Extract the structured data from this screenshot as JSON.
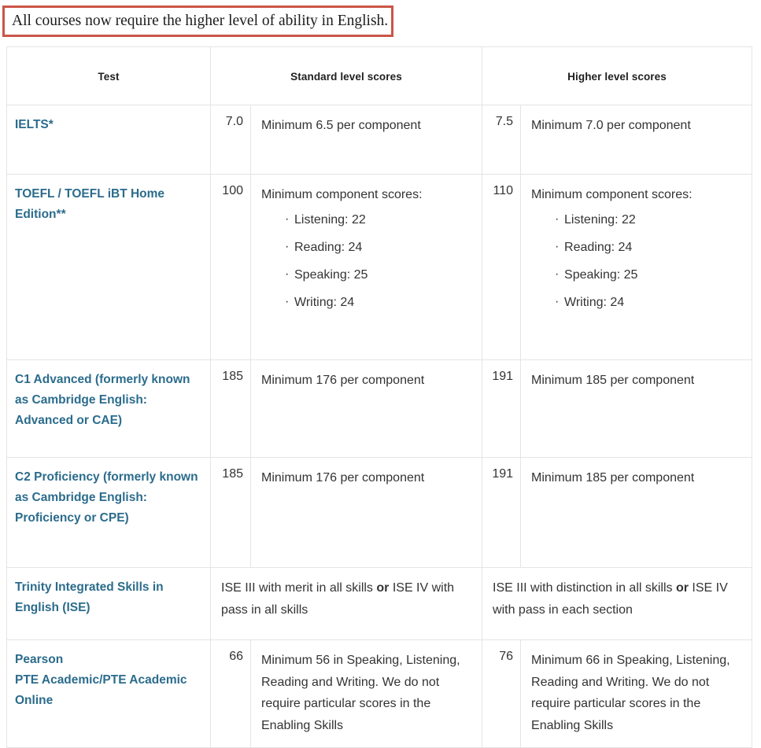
{
  "notice": {
    "text": "All courses now require the higher level of ability in English."
  },
  "table": {
    "headers": {
      "test": "Test",
      "standard": "Standard level scores",
      "higher": "Higher level scores"
    },
    "rows": [
      {
        "id": "ielts",
        "test_links": [
          "IELTS"
        ],
        "separator": "",
        "suffix": "*",
        "standard_score": "7.0",
        "standard_desc": "Minimum 6.5 per component",
        "higher_score": "7.5",
        "higher_desc": "Minimum 7.0 per component"
      },
      {
        "id": "toefl",
        "test_links": [
          "TOEFL",
          "TOEFL iBT Home Edition"
        ],
        "separator": " / ",
        "suffix": "**",
        "standard_score": "100",
        "standard_desc": "Minimum component scores:",
        "standard_components": [
          "Listening: 22",
          "Reading: 24",
          "Speaking: 25",
          "Writing: 24"
        ],
        "higher_score": "110",
        "higher_desc": "Minimum component scores:",
        "higher_components": [
          "Listening: 22",
          "Reading: 24",
          "Speaking: 25",
          "Writing: 24"
        ]
      },
      {
        "id": "c1",
        "test_links": [
          "C1 Advanced (formerly known as Cambridge English: Advanced or CAE)"
        ],
        "separator": "",
        "suffix": "",
        "standard_score": "185",
        "standard_desc": "Minimum 176 per component",
        "higher_score": "191",
        "higher_desc": "Minimum 185 per component"
      },
      {
        "id": "c2",
        "test_links": [
          "C2 Proficiency (formerly known as Cambridge English: Proficiency or CPE)"
        ],
        "separator": "",
        "suffix": "",
        "standard_score": "185",
        "standard_desc": "Minimum 176 per component",
        "higher_score": "191",
        "higher_desc": "Minimum 185 per component"
      },
      {
        "id": "trinity",
        "test_links": [
          "Trinity Integrated Skills in English (ISE)"
        ],
        "separator": "",
        "suffix": "",
        "standard_span_pre": "ISE III with merit in all skills ",
        "standard_span_bold": "or",
        "standard_span_post": " ISE IV with pass in all skills",
        "higher_span_pre": "ISE III with distinction in all skills ",
        "higher_span_bold": "or",
        "higher_span_post": " ISE IV with pass in each section"
      },
      {
        "id": "pearson",
        "test_links": [
          "Pearson",
          "PTE Academic/PTE Academic Online"
        ],
        "separator": "",
        "suffix": "",
        "standard_score": "66",
        "standard_desc": "Minimum 56 in Speaking, Listening, Reading and Writing. We do not require particular scores in the Enabling Skills",
        "higher_score": "76",
        "higher_desc": "Minimum 66 in Speaking, Listening, Reading and Writing. We do not require particular scores in the Enabling Skills"
      }
    ]
  },
  "colors": {
    "notice_border": "#cb5549",
    "link_blue": "#2b6c8c",
    "body_text": "#333333",
    "header_text": "#1f1f1f",
    "cell_border": "#e4e4e4"
  }
}
